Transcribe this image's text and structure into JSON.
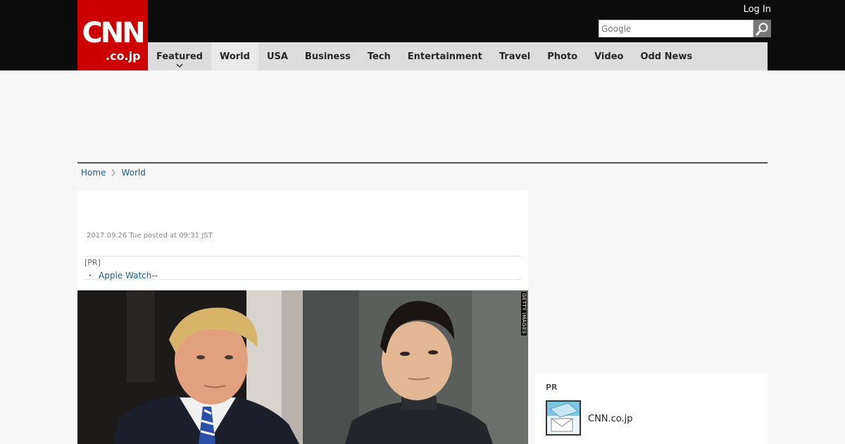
{
  "header": {
    "logo_main": "CNN",
    "logo_sub": ".co.jp",
    "login_label": "Log In",
    "search": {
      "placeholder": "Google"
    }
  },
  "nav": {
    "items": [
      {
        "label": "Featured"
      },
      {
        "label": "World"
      },
      {
        "label": "USA"
      },
      {
        "label": "Business"
      },
      {
        "label": "Tech"
      },
      {
        "label": "Entertainment"
      },
      {
        "label": "Travel"
      },
      {
        "label": "Photo"
      },
      {
        "label": "Video"
      },
      {
        "label": "Odd News"
      }
    ],
    "active": "World"
  },
  "breadcrumb": {
    "home": "Home",
    "current": "World"
  },
  "article": {
    "dateline": "2017.09.26 Tue posted at 09:31 JST",
    "pr_label": "[PR]",
    "pr_link": "Apple Watch--",
    "pr_bullet": "・",
    "photo_credit": "GETTY IMAGES"
  },
  "sidebar": {
    "pr_label": "PR",
    "pr_item_name": "CNN.co.jp"
  },
  "colors": {
    "brand_red": "#cc0000",
    "topbar": "#0c0c0c",
    "nav_bg": "#dddddd",
    "link_blue": "#1a5c8c"
  }
}
